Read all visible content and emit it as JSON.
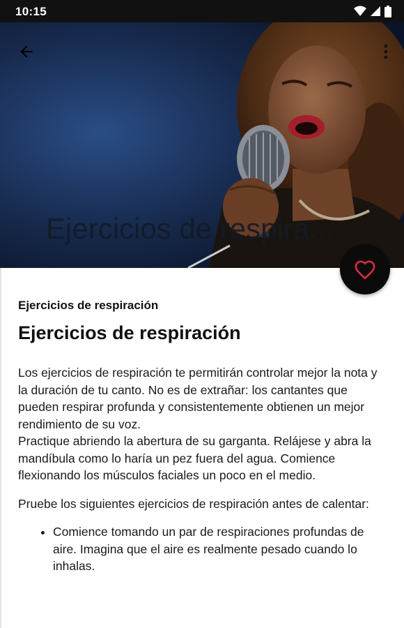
{
  "status_bar": {
    "time": "10:15",
    "icons": [
      "wifi-icon",
      "signal-icon",
      "battery-icon"
    ]
  },
  "toolbar": {
    "back_icon": "arrow-back-icon",
    "menu_icon": "more-vert-icon",
    "hero_title": "Ejercicios de respira..."
  },
  "fab": {
    "icon": "heart-outline-icon",
    "accent": "#d32f3f"
  },
  "article": {
    "section_label": "Ejercicios de respiración",
    "title": "Ejercicios de respiración",
    "paragraph1_line1": "Los ejercicios de respiración te permitirán controlar mejor la nota y la duración de tu canto. No es de extrañar: los cantantes que pueden respirar profunda y consistentemente obtienen un mejor rendimiento de su voz.",
    "paragraph1_line2": "Practique abriendo la abertura de su garganta. Relájese y abra la mandíbula como lo haría un pez fuera del agua. Comience flexionando los músculos faciales un poco en el medio.",
    "paragraph2": "Pruebe los siguientes ejercicios de respiración antes de calentar:",
    "bullet1": "Comience tomando un par de respiraciones profundas de aire. Imagina que el aire es realmente pesado cuando lo inhalas."
  },
  "colors": {
    "status_bar": "#111111",
    "hero_bg": "#0f1d38",
    "fab_bg": "#0b0b0b",
    "fab_icon": "#d32f3f"
  }
}
